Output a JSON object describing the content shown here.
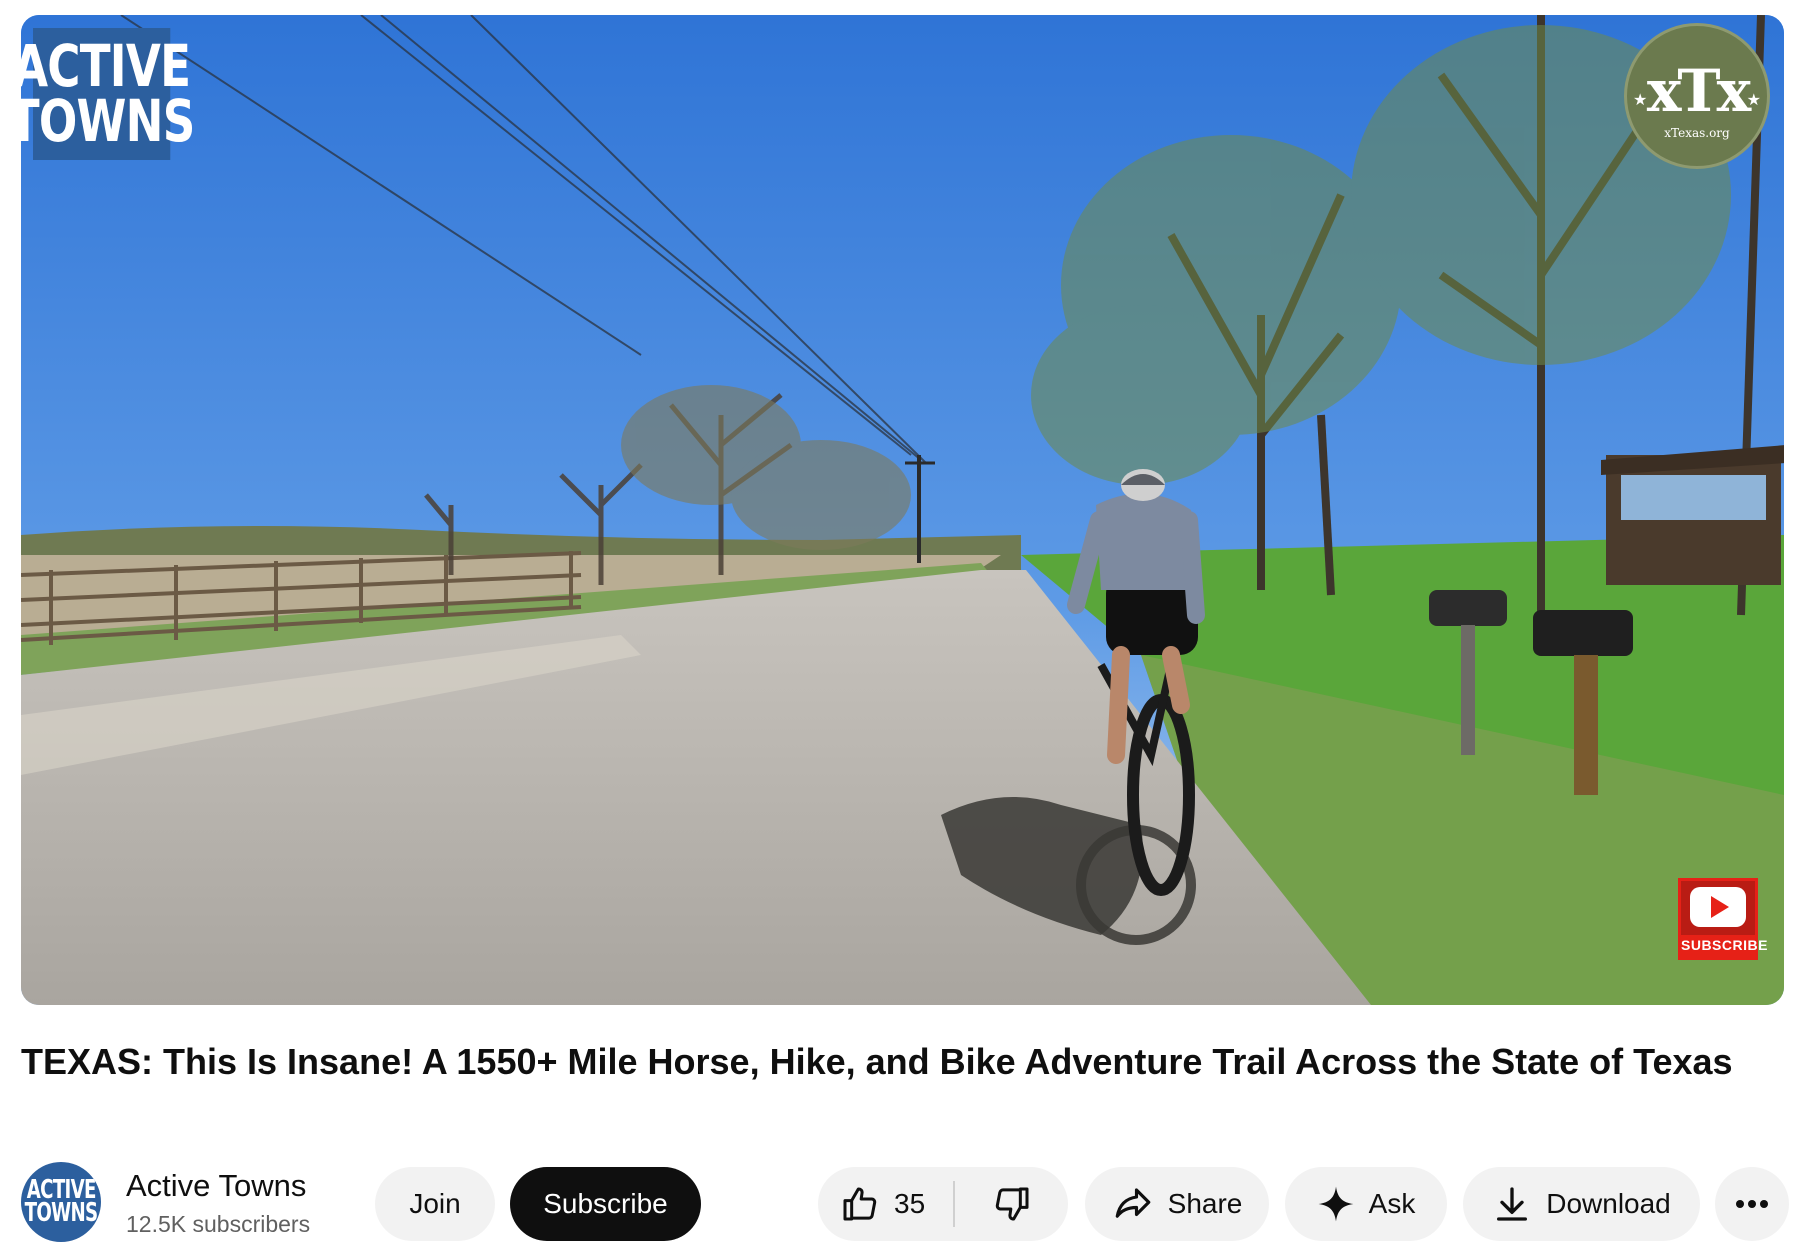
{
  "video": {
    "overlay_logo_left": [
      "ACTIVE",
      "TOWNS"
    ],
    "overlay_logo_right": {
      "big": "xTx",
      "small": "xTexas.org",
      "icon": "xtexas-seal"
    },
    "subscribe_watermark": {
      "label": "SUBSCRIBE",
      "icon": "youtube-play-icon"
    }
  },
  "title": "TEXAS: This Is Insane! A 1550+ Mile Horse, Hike, and Bike Adventure Trail Across the State of Texas",
  "channel": {
    "avatar_text": [
      "ACTIVE",
      "TOWNS"
    ],
    "name": "Active Towns",
    "subscribers": "12.5K subscribers"
  },
  "actions": {
    "join": "Join",
    "subscribe": "Subscribe",
    "like_count": "35",
    "share": "Share",
    "ask": "Ask",
    "download": "Download"
  },
  "colors": {
    "subscribe_bg": "#0f0f0f",
    "pill_bg": "#f2f2f2",
    "secondary_text": "#606060",
    "channel_brand": "#2c5f9e"
  }
}
